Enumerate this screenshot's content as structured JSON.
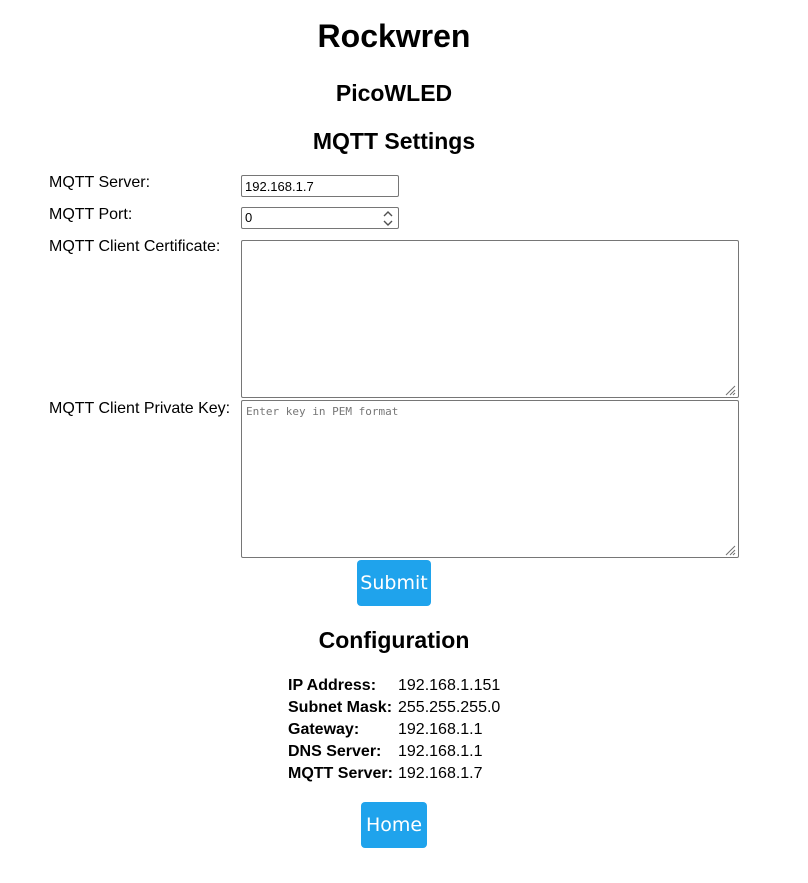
{
  "header": {
    "title": "Rockwren",
    "subtitle": "PicoWLED"
  },
  "mqtt_settings": {
    "heading": "MQTT Settings",
    "server": {
      "label": "MQTT Server:",
      "value": "192.168.1.7"
    },
    "port": {
      "label": "MQTT Port:",
      "value": "0"
    },
    "client_certificate": {
      "label": "MQTT Client Certificate:",
      "value": "",
      "placeholder": ""
    },
    "private_key": {
      "label": "MQTT Client Private Key:",
      "value": "",
      "placeholder": "Enter key in PEM format"
    },
    "submit_label": "Submit"
  },
  "configuration": {
    "heading": "Configuration",
    "rows": [
      {
        "key": "IP Address:",
        "value": "192.168.1.151"
      },
      {
        "key": "Subnet Mask:",
        "value": "255.255.255.0"
      },
      {
        "key": "Gateway:",
        "value": "192.168.1.1"
      },
      {
        "key": "DNS Server:",
        "value": "192.168.1.1"
      },
      {
        "key": "MQTT Server:",
        "value": "192.168.1.7"
      }
    ]
  },
  "nav": {
    "home_label": "Home"
  },
  "colors": {
    "button_bg": "#1fa3ec",
    "button_text": "#ffffff",
    "input_border": "#767676",
    "placeholder_text": "#767676"
  },
  "icons": {
    "spinner": "spinner-arrows-icon",
    "resize": "resize-grip-icon"
  }
}
